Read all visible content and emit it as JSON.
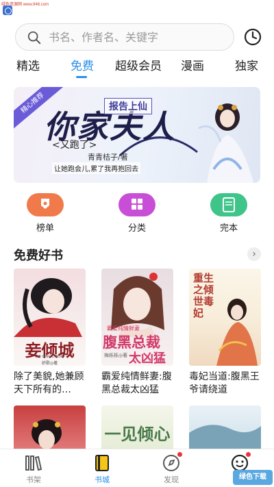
{
  "watermark": {
    "text": "绿色资源网 www.948.com"
  },
  "search": {
    "placeholder": "书名、作者名、关键字"
  },
  "tabs": [
    {
      "label": "精选",
      "active": false
    },
    {
      "label": "免费",
      "active": true
    },
    {
      "label": "超级会员",
      "active": false
    },
    {
      "label": "漫画",
      "active": false
    },
    {
      "label": "独家",
      "active": false
    }
  ],
  "banner": {
    "corner": "精心推荐",
    "badge": "报告上仙",
    "title": "你家夫人",
    "subtitle": "<又跑了>",
    "author": "青青桔子/著",
    "slogan": "让她跑会儿,累了我再抱回去"
  },
  "quick_links": [
    {
      "label": "榜单",
      "color": "#f07a4a"
    },
    {
      "label": "分类",
      "color": "#c84ed8"
    },
    {
      "label": "完本",
      "color": "#3fc48a"
    }
  ],
  "section": {
    "title": "免费好书",
    "more": "›"
  },
  "books": [
    {
      "title": "除了美貌,她兼顾天下所有的…",
      "cover_title": "妾倾城",
      "cover_pinyin": "QIE QING CHENG",
      "cover_author": "舒歌◎著"
    },
    {
      "title": "霸爱纯情鲜妻:腹黑总裁太凶猛",
      "cover_tag": "霸爱纯情鲜妻",
      "cover_title_1": "腹黑总裁",
      "cover_title_2": "太凶猛",
      "cover_author": "梅栎栎◎著"
    },
    {
      "title": "毒妃当道:腹黑王爷请绕道",
      "cover_title": "重生之倾世毒妃"
    }
  ],
  "books_row2": [
    {
      "cover_text": ""
    },
    {
      "cover_title": "一见倾心"
    },
    {
      "cover_text": ""
    }
  ],
  "bottom_nav": [
    {
      "label": "书架",
      "active": false,
      "dot": false
    },
    {
      "label": "书城",
      "active": true,
      "dot": false
    },
    {
      "label": "发现",
      "active": false,
      "dot": true
    },
    {
      "label": "",
      "active": false,
      "dot": true
    }
  ],
  "corner_badge": {
    "text": "绿色下载"
  },
  "colors": {
    "accent": "#2a8ee8",
    "notification": "#e8343f"
  }
}
